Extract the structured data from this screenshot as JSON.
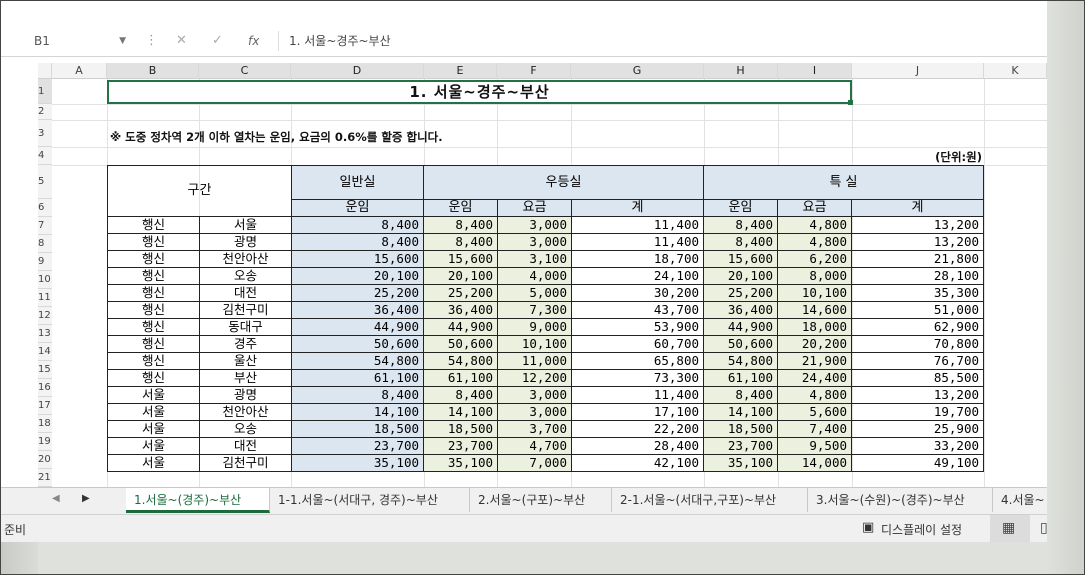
{
  "formula_bar": {
    "name_box": "B1",
    "cancel_icon": "✕",
    "enter_icon": "✓",
    "fx_label": "fx",
    "formula": "1. 서울~경주~부산"
  },
  "columns": [
    "A",
    "B",
    "C",
    "D",
    "E",
    "F",
    "G",
    "H",
    "I",
    "J",
    "K"
  ],
  "rows": [
    "1",
    "2",
    "3",
    "4",
    "5",
    "6",
    "7",
    "8",
    "9",
    "10",
    "11",
    "12",
    "13",
    "14",
    "15",
    "16",
    "17",
    "18",
    "19",
    "20",
    "21"
  ],
  "sheet": {
    "title": "1.  서울~경주~부산",
    "note": "※ 도중 정차역 2개 이하 열차는 운임, 요금의 0.6%를 할증 합니다.",
    "unit": "(단위:원)",
    "header": {
      "section": "구간",
      "general": "일반실",
      "first": "우등실",
      "special": "특  실",
      "fare": "운임",
      "fee": "요금",
      "total": "계"
    },
    "rows": [
      [
        "행신",
        "서울",
        "8,400",
        "8,400",
        "3,000",
        "11,400",
        "8,400",
        "4,800",
        "13,200"
      ],
      [
        "행신",
        "광명",
        "8,400",
        "8,400",
        "3,000",
        "11,400",
        "8,400",
        "4,800",
        "13,200"
      ],
      [
        "행신",
        "천안아산",
        "15,600",
        "15,600",
        "3,100",
        "18,700",
        "15,600",
        "6,200",
        "21,800"
      ],
      [
        "행신",
        "오송",
        "20,100",
        "20,100",
        "4,000",
        "24,100",
        "20,100",
        "8,000",
        "28,100"
      ],
      [
        "행신",
        "대전",
        "25,200",
        "25,200",
        "5,000",
        "30,200",
        "25,200",
        "10,100",
        "35,300"
      ],
      [
        "행신",
        "김천구미",
        "36,400",
        "36,400",
        "7,300",
        "43,700",
        "36,400",
        "14,600",
        "51,000"
      ],
      [
        "행신",
        "동대구",
        "44,900",
        "44,900",
        "9,000",
        "53,900",
        "44,900",
        "18,000",
        "62,900"
      ],
      [
        "행신",
        "경주",
        "50,600",
        "50,600",
        "10,100",
        "60,700",
        "50,600",
        "20,200",
        "70,800"
      ],
      [
        "행신",
        "울산",
        "54,800",
        "54,800",
        "11,000",
        "65,800",
        "54,800",
        "21,900",
        "76,700"
      ],
      [
        "행신",
        "부산",
        "61,100",
        "61,100",
        "12,200",
        "73,300",
        "61,100",
        "24,400",
        "85,500"
      ],
      [
        "서울",
        "광명",
        "8,400",
        "8,400",
        "3,000",
        "11,400",
        "8,400",
        "4,800",
        "13,200"
      ],
      [
        "서울",
        "천안아산",
        "14,100",
        "14,100",
        "3,000",
        "17,100",
        "14,100",
        "5,600",
        "19,700"
      ],
      [
        "서울",
        "오송",
        "18,500",
        "18,500",
        "3,700",
        "22,200",
        "18,500",
        "7,400",
        "25,900"
      ],
      [
        "서울",
        "대전",
        "23,700",
        "23,700",
        "4,700",
        "28,400",
        "23,700",
        "9,500",
        "33,200"
      ],
      [
        "서울",
        "김천구미",
        "35,100",
        "35,100",
        "7,000",
        "42,100",
        "35,100",
        "14,000",
        "49,100"
      ]
    ]
  },
  "tabs": [
    "1.서울~(경주)~부산",
    "1-1.서울~(서대구, 경주)~부산",
    "2.서울~(구포)~부산",
    "2-1.서울~(서대구,구포)~부산",
    "3.서울~(수원)~(경주)~부산",
    "4.서울~"
  ],
  "status": {
    "ready": "준비",
    "display_settings": "디스플레이 설정"
  }
}
